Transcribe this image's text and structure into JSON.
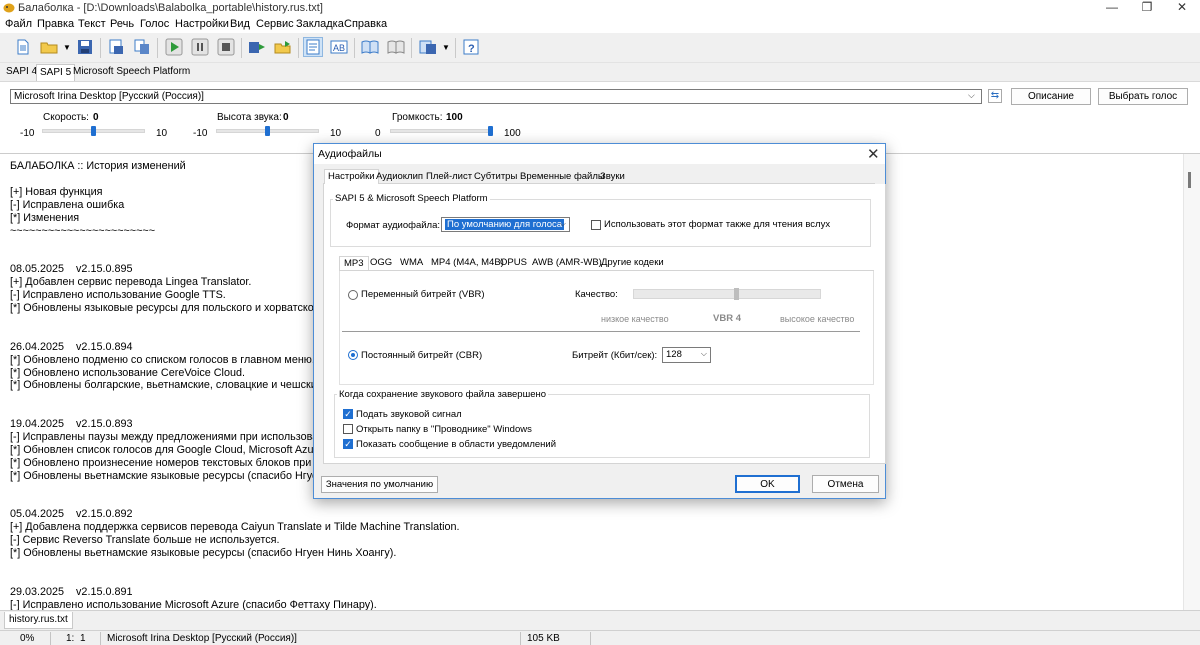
{
  "window": {
    "title": "Балаболка - [D:\\Downloads\\Balabolka_portable\\history.rus.txt]",
    "controls": [
      "—",
      "❐",
      "✕"
    ]
  },
  "menu": [
    "Файл",
    "Правка",
    "Текст",
    "Речь",
    "Голос",
    "Настройки",
    "Вид",
    "Сервис",
    "Закладка",
    "Справка"
  ],
  "api_tabs": [
    "SAPI 4",
    "SAPI 5",
    "Microsoft Speech Platform"
  ],
  "voice": {
    "selected": "Microsoft Irina Desktop [Русский (Россия)]",
    "describe_button": "Описание",
    "choose_button": "Выбрать голос",
    "rate": {
      "label": "Скорость:",
      "value": "0",
      "min": "-10",
      "max": "10",
      "level": 0.5
    },
    "pitch": {
      "label": "Высота звука:",
      "value": "0",
      "min": "-10",
      "max": "10",
      "level": 0.5
    },
    "volume": {
      "label": "Громкость:",
      "value": "100",
      "min": "0",
      "max": "100",
      "level": 1.0
    }
  },
  "editor": {
    "text": "БАЛАБОЛКА :: История изменений\n\n[+] Новая функция\n[-] Исправлена ошибка\n[*] Изменения\n~~~~~~~~~~~~~~~~~~~~~~~\n\n\n08.05.2025    v2.15.0.895\n[+] Добавлен сервис перевода Lingea Translator.\n[-] Исправлено использование Google TTS.\n[*] Обновлены языковые ресурсы для польского и хорватского\n\n\n26.04.2025    v2.15.0.894\n[*] Обновлено подменю со списком голосов в главном меню.\n[*] Обновлено использование CereVoice Cloud.\n[*] Обновлены болгарские, вьетнамские, словацкие и чешские\n\n\n19.04.2025    v2.15.0.893\n[-] Исправлены паузы между предложениями при использова\n[*] Обновлен список голосов для Google Cloud, Microsoft Azure и\n[*] Обновлено произнесение номеров текстовых блоков при с\n[*] Обновлены вьетнамские языковые ресурсы (спасибо Нгуен\n\n\n05.04.2025    v2.15.0.892\n[+] Добавлена поддержка сервисов перевода Caiyun Translate и Tilde Machine Translation.\n[-] Сервис Reverso Translate больше не используется.\n[*] Обновлены вьетнамские языковые ресурсы (спасибо Нгуен Нинь Хоангу).\n\n\n29.03.2025    v2.15.0.891\n[-] Исправлено использование Microsoft Azure (спасибо Феттаху Пинару)."
  },
  "doc_tab": "history.rus.txt",
  "status": {
    "progress": "0%",
    "line": "1:",
    "col": "1",
    "voice": "Microsoft Irina Desktop [Русский (Россия)]",
    "size": "105 KB"
  },
  "dialog": {
    "title": "Аудиофайлы",
    "tabs": [
      "Настройки",
      "Аудиоклип",
      "Плей-лист",
      "Субтитры",
      "Временные файлы",
      "Звуки"
    ],
    "group_title": "SAPI 5 & Microsoft Speech Platform",
    "format_label": "Формат аудиофайла:",
    "format_value": "По умолчанию для голоса",
    "use_for_reading_label": "Использовать этот формат также для чтения вслух",
    "use_for_reading_checked": false,
    "format_tabs": [
      "MP3",
      "OGG",
      "WMA",
      "MP4 (M4A, M4B)",
      "OPUS",
      "AWB (AMR-WB)",
      "Другие кодеки"
    ],
    "vbr_label": "Переменный битрейт (VBR)",
    "vbr_selected": false,
    "quality_label": "Качество:",
    "quality_low": "низкое качество",
    "quality_value": "VBR 4",
    "quality_high": "высокое качество",
    "quality_level": 0.55,
    "cbr_label": "Постоянный битрейт (CBR)",
    "cbr_selected": true,
    "bitrate_label": "Битрейт (Кбит/сек):",
    "bitrate_value": "128",
    "on_complete_title": "Когда сохранение звукового файла завершено",
    "options": [
      {
        "label": "Подать звуковой сигнал",
        "checked": true
      },
      {
        "label": "Открыть папку в \"Проводнике\" Windows",
        "checked": false
      },
      {
        "label": "Показать сообщение в области уведомлений",
        "checked": true
      }
    ],
    "defaults_button": "Значения по умолчанию",
    "ok_button": "OK",
    "cancel_button": "Отмена"
  }
}
